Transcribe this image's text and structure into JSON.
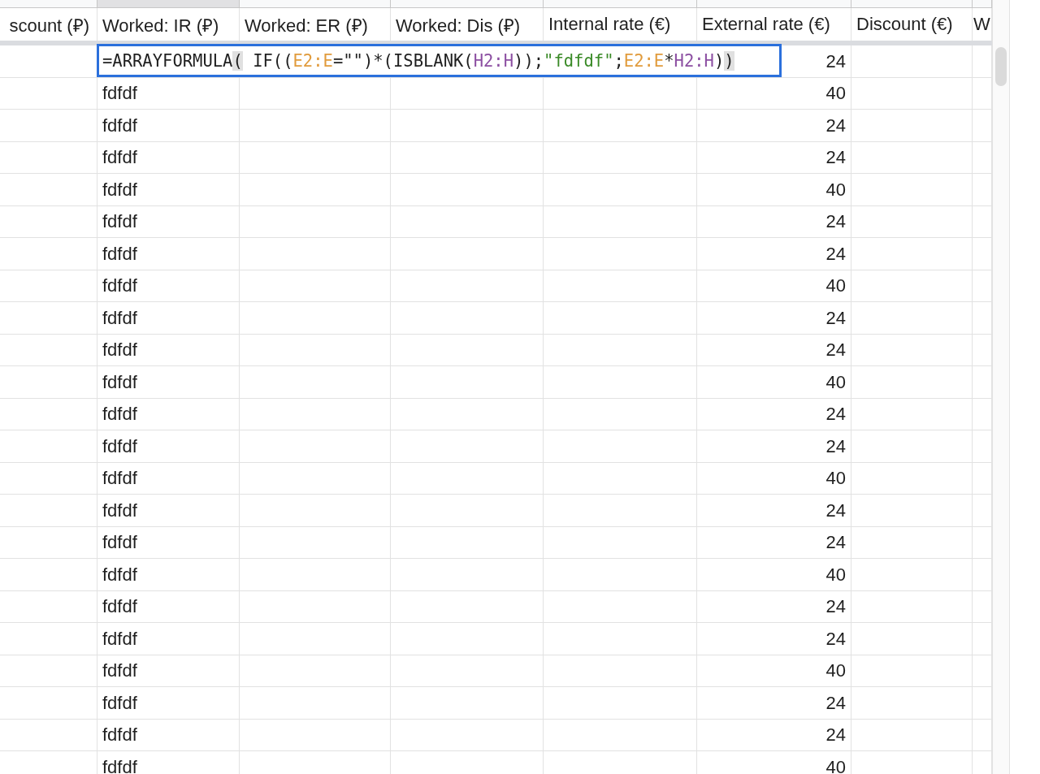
{
  "columns": [
    {
      "label": "scount (₽)",
      "selected": false
    },
    {
      "label": "Worked: IR (₽)",
      "selected": true
    },
    {
      "label": "Worked: ER (₽)",
      "selected": false
    },
    {
      "label": "Worked: Dis (₽)",
      "selected": false
    },
    {
      "label": "Internal rate (€)",
      "selected": false
    },
    {
      "label": "External rate (€)",
      "selected": false
    },
    {
      "label": "Discount (€)",
      "selected": false
    },
    {
      "label": "W",
      "selected": false
    }
  ],
  "formula_row": {
    "formula": [
      {
        "kind": "plain",
        "text": "=ARRAYFORMULA"
      },
      {
        "kind": "paren",
        "text": "("
      },
      {
        "kind": "plain",
        "text": " IF(("
      },
      {
        "kind": "ref1",
        "text": "E2:E"
      },
      {
        "kind": "plain",
        "text": "=\"\")*(ISBLANK("
      },
      {
        "kind": "ref2",
        "text": "H2:H"
      },
      {
        "kind": "plain",
        "text": "));"
      },
      {
        "kind": "string",
        "text": "\"fdfdf\""
      },
      {
        "kind": "plain",
        "text": ";"
      },
      {
        "kind": "ref1",
        "text": "E2:E"
      },
      {
        "kind": "plain",
        "text": "*"
      },
      {
        "kind": "ref2",
        "text": "H2:H"
      },
      {
        "kind": "plain",
        "text": ")"
      },
      {
        "kind": "paren",
        "text": ")"
      }
    ],
    "rate": "24"
  },
  "rows": [
    {
      "text": "fdfdf",
      "rate": "40"
    },
    {
      "text": "fdfdf",
      "rate": "24"
    },
    {
      "text": "fdfdf",
      "rate": "24"
    },
    {
      "text": "fdfdf",
      "rate": "40"
    },
    {
      "text": "fdfdf",
      "rate": "24"
    },
    {
      "text": "fdfdf",
      "rate": "24"
    },
    {
      "text": "fdfdf",
      "rate": "40"
    },
    {
      "text": "fdfdf",
      "rate": "24"
    },
    {
      "text": "fdfdf",
      "rate": "24"
    },
    {
      "text": "fdfdf",
      "rate": "40"
    },
    {
      "text": "fdfdf",
      "rate": "24"
    },
    {
      "text": "fdfdf",
      "rate": "24"
    },
    {
      "text": "fdfdf",
      "rate": "40"
    },
    {
      "text": "fdfdf",
      "rate": "24"
    },
    {
      "text": "fdfdf",
      "rate": "24"
    },
    {
      "text": "fdfdf",
      "rate": "40"
    },
    {
      "text": "fdfdf",
      "rate": "24"
    },
    {
      "text": "fdfdf",
      "rate": "24"
    },
    {
      "text": "fdfdf",
      "rate": "40"
    },
    {
      "text": "fdfdf",
      "rate": "24"
    },
    {
      "text": "fdfdf",
      "rate": "24"
    },
    {
      "text": "fdfdf",
      "rate": "40"
    }
  ]
}
